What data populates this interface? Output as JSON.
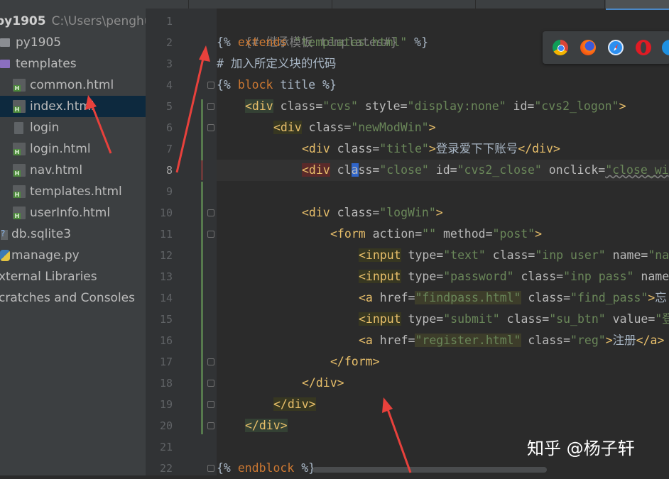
{
  "project": {
    "name": "py1905",
    "path": "C:\\Users\\penghu"
  },
  "tree": [
    {
      "label": "py1905",
      "icon": "folder-icon"
    },
    {
      "label": "templates",
      "icon": "folder-icon"
    },
    {
      "label": "common.html",
      "icon": "html-file-icon"
    },
    {
      "label": "index.html",
      "icon": "html-file-icon",
      "selected": true
    },
    {
      "label": "login",
      "icon": "file-icon"
    },
    {
      "label": "login.html",
      "icon": "html-file-icon"
    },
    {
      "label": "nav.html",
      "icon": "html-file-icon"
    },
    {
      "label": "templates.html",
      "icon": "html-file-icon"
    },
    {
      "label": "userInfo.html",
      "icon": "html-file-icon"
    },
    {
      "label": "db.sqlite3",
      "icon": "database-file-icon"
    },
    {
      "label": "manage.py",
      "icon": "python-file-icon"
    },
    {
      "label": "xternal Libraries",
      "icon": ""
    },
    {
      "label": "cratches and Consoles",
      "icon": ""
    }
  ],
  "line_numbers": [
    "1",
    "2",
    "3",
    "4",
    "5",
    "6",
    "7",
    "8",
    "9",
    "10",
    "11",
    "12",
    "13",
    "14",
    "15",
    "16",
    "17",
    "18",
    "19",
    "20",
    "21",
    "22"
  ],
  "current_line": "8",
  "code": {
    "l1": "{# 继承模板 templates#}",
    "l2_a": "{% ",
    "l2_kw": "extends",
    "l2_str": "\"templates.html\"",
    "l2_b": " %}",
    "l3": "# 加入所定义块的代码",
    "l4_a": "{% ",
    "l4_kw": "block",
    "l4_b": " title %}",
    "l5_tag": "<div",
    "l5_attr1": " class=",
    "l5_v1": "\"cvs\"",
    "l5_attr2": " style=",
    "l5_v2": "\"display:none\"",
    "l5_attr3": " id=",
    "l5_v3": "\"cvs2_logon\"",
    "l5_end": ">",
    "l6_tag": "<div",
    "l6_attr1": " class=",
    "l6_v1": "\"newModWin\"",
    "l6_end": ">",
    "l7_tag": "<div",
    "l7_attr1": " class=",
    "l7_v1": "\"title\"",
    "l7_end": ">",
    "l7_text": "登录爱下下账号",
    "l7_close": "</div>",
    "l8_tag": "<div",
    "l8_attr1": " cl",
    "l8_caret": "a",
    "l8_attr1b": "ss=",
    "l8_v1": "\"close\"",
    "l8_attr2": " id=",
    "l8_v2": "\"cvs2_close\"",
    "l8_attr3": " onclick=",
    "l8_v3": "\"close_wi",
    "l10_tag": "<div",
    "l10_attr1": " class=",
    "l10_v1": "\"logWin\"",
    "l10_end": ">",
    "l11_tag": "<form",
    "l11_attr1": " action=",
    "l11_v1": "\"\"",
    "l11_attr2": " method=",
    "l11_v2": "\"post\"",
    "l11_end": ">",
    "l12_tag": "<input",
    "l12_attr1": " type=",
    "l12_v1": "\"text\"",
    "l12_attr2": " class=",
    "l12_v2": "\"inp user\"",
    "l12_attr3": " name=",
    "l12_v3": "\"na",
    "l13_tag": "<input",
    "l13_attr1": " type=",
    "l13_v1": "\"password\"",
    "l13_attr2": " class=",
    "l13_v2": "\"inp pass\"",
    "l13_attr3": " name",
    "l14_tag": "<a",
    "l14_attr1": " href=",
    "l14_v1": "\"findpass.html\"",
    "l14_attr2": " class=",
    "l14_v2": "\"find_pass\"",
    "l14_end": ">",
    "l14_text": "忘",
    "l15_tag": "<input",
    "l15_attr1": " type=",
    "l15_v1": "\"submit\"",
    "l15_attr2": " class=",
    "l15_v2": "\"su_btn\"",
    "l15_attr3": " value=",
    "l15_v3": "\"登",
    "l16_tag": "<a",
    "l16_attr1": " href=",
    "l16_v1": "\"register.html\"",
    "l16_attr2": " class=",
    "l16_v2": "\"reg\"",
    "l16_end": ">",
    "l16_text": "注册",
    "l16_close": "</a>",
    "l17": "</form>",
    "l18": "</div>",
    "l19": "</div>",
    "l20": "</div>",
    "l22_a": "{% ",
    "l22_kw": "endblock",
    "l22_b": " %}"
  },
  "browsers": [
    "chrome-icon",
    "firefox-icon",
    "safari-icon",
    "opera-icon",
    "ie-icon"
  ],
  "watermark": "知乎 @杨子轩",
  "colors": {
    "background": "#2b2b2b",
    "sidebar": "#3c3f41",
    "keyword": "#cc7832",
    "tag": "#e8bf6a",
    "string": "#6a8759",
    "annotation_arrow": "#e8413c"
  }
}
